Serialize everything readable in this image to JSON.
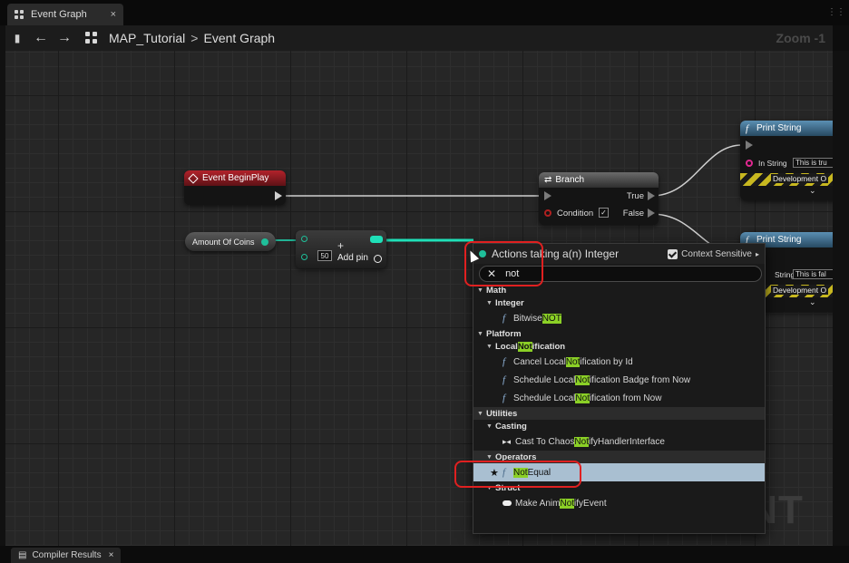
{
  "tab": {
    "title": "Event Graph",
    "close": "×"
  },
  "toolbar": {
    "breadcrumb_root": "MAP_Tutorial",
    "separator": ">",
    "breadcrumb_leaf": "Event Graph",
    "zoom": "Zoom -1"
  },
  "nodes": {
    "begin_play": {
      "title": "Event BeginPlay"
    },
    "amount_of_coins": {
      "title": "Amount Of Coins"
    },
    "add": {
      "value": "50",
      "plus": "+",
      "add_pin": "Add pin"
    },
    "branch": {
      "title": "Branch",
      "true_label": "True",
      "false_label": "False",
      "condition_label": "Condition"
    },
    "print_string_1": {
      "title": "Print String",
      "in_string_label": "In String",
      "in_string_value": "This is tru",
      "dev_label": "Development O"
    },
    "print_string_2": {
      "title": "Print String",
      "in_string_label": "String",
      "in_string_value": "This is fal",
      "dev_label": "Development O"
    }
  },
  "popup": {
    "title": "Actions taking a(n) Integer",
    "context_sensitive": "Context Sensitive",
    "search_value": "not",
    "sections": {
      "math": "Math",
      "integer": "Integer",
      "bitwise_pre": "Bitwise ",
      "bitwise_hl": "NOT",
      "platform": "Platform",
      "local_notification_pre": "Local ",
      "local_notification_hl": "Not",
      "local_notification_post": "ification",
      "cancel_pre": "Cancel Local ",
      "cancel_hl": "Not",
      "cancel_post": "ification by Id",
      "badge_pre": "Schedule Local ",
      "badge_hl": "Not",
      "badge_post": "ification Badge from Now",
      "schedule_pre": "Schedule Local ",
      "schedule_hl": "Not",
      "schedule_post": "ification from Now",
      "utilities": "Utilities",
      "casting": "Casting",
      "cast_pre": "Cast To Chaos",
      "cast_hl": "Not",
      "cast_post": "ifyHandlerInterface",
      "operators": "Operators",
      "not_equal_hl": "Not",
      "not_equal_post": " Equal",
      "struct": "Struct",
      "make_pre": "Make Anim",
      "make_hl": "Not",
      "make_post": "ifyEvent"
    }
  },
  "watermark": "INT",
  "bottom_tab": {
    "label": "Compiler Results",
    "close": "×"
  },
  "colors": {
    "exec_wire": "#cfcfcf",
    "int_wire": "#1fe0b8",
    "highlight": "#8bd026",
    "selected_row": "#a9bfd1",
    "annotation": "#e02020"
  }
}
